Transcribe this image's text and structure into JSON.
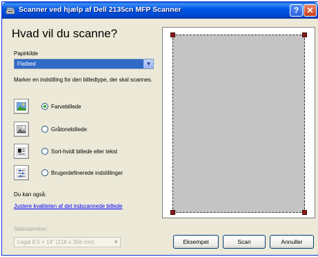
{
  "window": {
    "title": "Scanner ved hjælp af Dell 2135cn MFP Scanner",
    "help_button": "?",
    "close_button": "✕"
  },
  "dialog": {
    "heading": "Hvad vil du scanne?",
    "paper_source_label": "Papirkilde",
    "paper_source_value": "Flatbed",
    "hint": "Marker en indstilling for den billedtype, der skal scannes.",
    "options": [
      {
        "label": "Farvebillede",
        "selected": true,
        "icon": "color-picture-icon"
      },
      {
        "label": "Gråtonebillede",
        "selected": false,
        "icon": "grayscale-picture-icon"
      },
      {
        "label": "Sort-hvidt billede eller tekst",
        "selected": false,
        "icon": "black-white-text-icon"
      },
      {
        "label": "Brugerdefinerede indstillinger",
        "selected": false,
        "icon": "custom-settings-icon"
      }
    ],
    "also_label": "Du kan også:",
    "adjust_link": "Justere kvaliteten af det indscannede billede",
    "page_size_label": "Sidestørrelse:",
    "page_size_value": "Legal 8.5 × 14\" (216 x 356 mm)"
  },
  "buttons": {
    "preview": "Eksempel",
    "scan": "Scan",
    "cancel": "Annuller"
  },
  "colors": {
    "titlebar": "#0054e3",
    "selected_field": "#3169c6",
    "radio_dot": "#21a121",
    "link": "#0000ff",
    "handle": "#8b1a1a"
  }
}
